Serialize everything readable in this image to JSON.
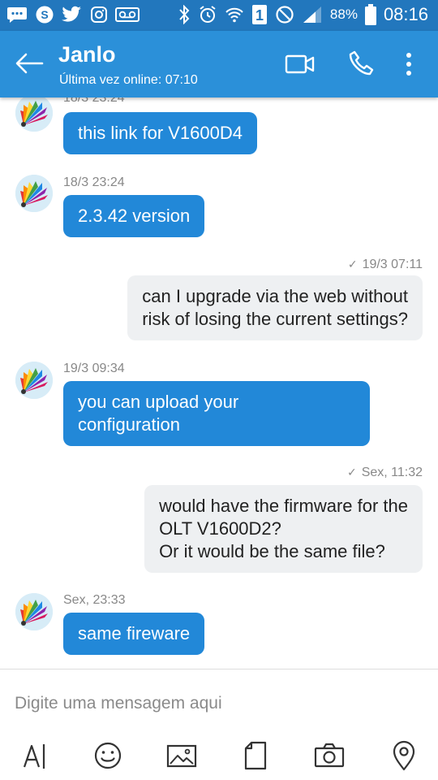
{
  "status_bar": {
    "battery": "88%",
    "time": "08:16",
    "sim": "1"
  },
  "header": {
    "name": "Janlo",
    "last_seen": "Última vez online: 07:10"
  },
  "messages": [
    {
      "dir": "in",
      "time": "18/3 23:24",
      "text": "this link for V1600D4"
    },
    {
      "dir": "in",
      "time": "18/3 23:24",
      "text": "2.3.42 version"
    },
    {
      "dir": "out",
      "time": "19/3 07:11",
      "text": "can I upgrade via the web without\nrisk of losing the current settings?"
    },
    {
      "dir": "in",
      "time": "19/3 09:34",
      "text": "you can upload your\nconfiguration"
    },
    {
      "dir": "out",
      "time": "Sex, 11:32",
      "text": "would have the firmware for the\nOLT V1600D2?\nOr it would be the same file?"
    },
    {
      "dir": "in",
      "time": "Sex, 23:33",
      "text": "same fireware"
    }
  ],
  "composer": {
    "placeholder": "Digite uma mensagem aqui"
  },
  "colors": {
    "status_bar": "#2277bd",
    "app_bar": "#2b90d9",
    "incoming_bubble": "#2288d8",
    "outgoing_bubble": "#eef0f2"
  },
  "icons": {
    "toolbar": [
      "text-format-icon",
      "emoji-icon",
      "image-icon",
      "file-icon",
      "camera-icon",
      "location-icon"
    ]
  }
}
